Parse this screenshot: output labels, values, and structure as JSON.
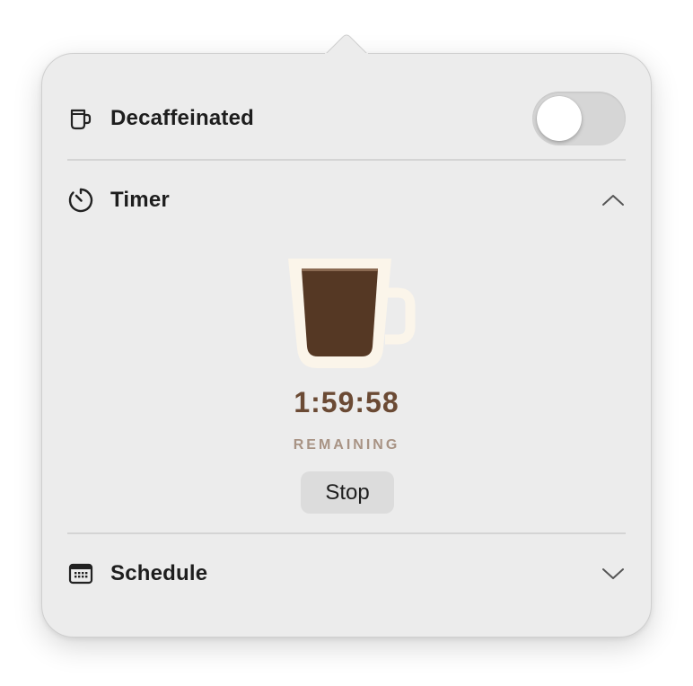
{
  "popover": {
    "decaf": {
      "label": "Decaffeinated",
      "icon": "cup-icon",
      "toggle_on": false
    },
    "timer": {
      "label": "Timer",
      "icon": "timer-icon",
      "expanded": true,
      "value": "1:59:58",
      "caption": "REMAINING",
      "stop_label": "Stop"
    },
    "schedule": {
      "label": "Schedule",
      "icon": "calendar-icon",
      "expanded": false
    }
  },
  "colors": {
    "background": "#ececec",
    "coffee": "#553824",
    "cup_outline": "#fbf5ea",
    "timer_text": "#6b4a34",
    "caption_text": "#a89384"
  }
}
